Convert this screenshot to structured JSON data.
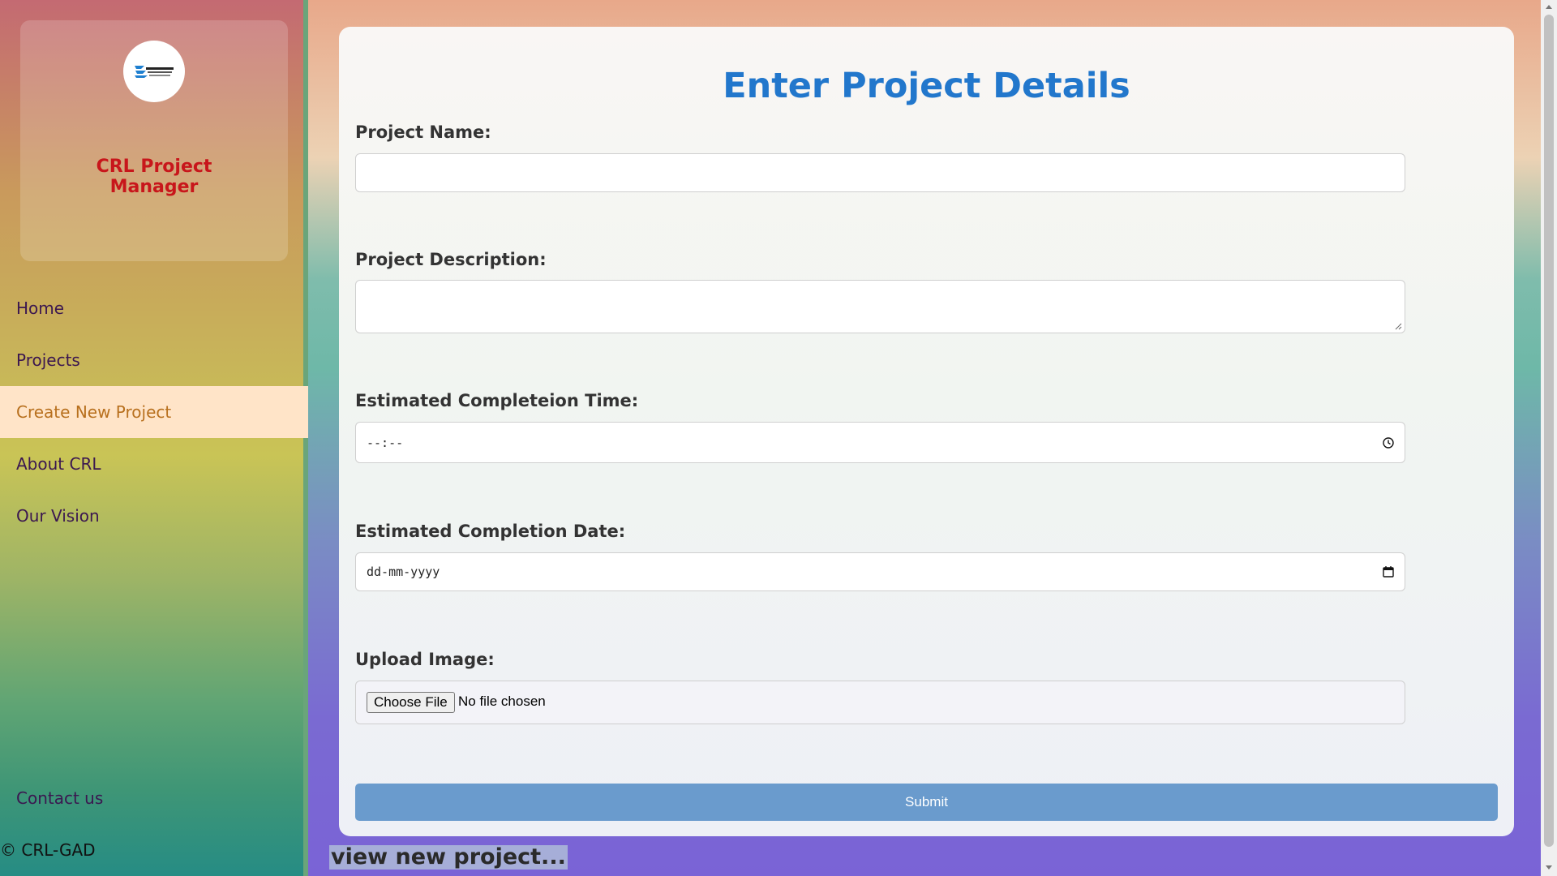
{
  "sidebar": {
    "brand_name": "CRL Project Manager",
    "logo_icon": "company-logo",
    "items": [
      {
        "label": "Home",
        "active": false
      },
      {
        "label": "Projects",
        "active": false
      },
      {
        "label": "Create New Project",
        "active": true
      },
      {
        "label": "About CRL",
        "active": false
      },
      {
        "label": "Our Vision",
        "active": false
      }
    ],
    "contact_label": "Contact us",
    "copyright": "© CRL-GAD"
  },
  "form": {
    "title": "Enter Project Details",
    "project_name_label": "Project Name:",
    "project_name_value": "",
    "description_label": "Project Description:",
    "description_value": "",
    "time_label": "Estimated Completeion Time:",
    "time_value": "--:--",
    "date_label": "Estimated Completion Date:",
    "date_value": "dd-mm-yyyy",
    "image_label": "Upload Image:",
    "choose_file_label": "Choose File",
    "file_status": "No file chosen",
    "submit_label": "Submit"
  },
  "view_link": "view new project...",
  "colors": {
    "title": "#2277cc",
    "brand": "#c8161b",
    "nav_text": "#3b1750",
    "active_bg": "#ffe4c8",
    "active_text": "#b8701e",
    "submit_bg": "#6a9bcd"
  }
}
